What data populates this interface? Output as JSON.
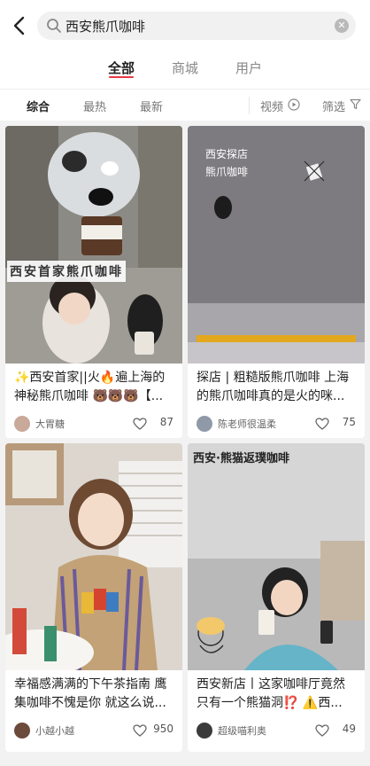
{
  "search": {
    "query": "西安熊爪咖啡"
  },
  "tabs": [
    {
      "label": "全部",
      "active": true
    },
    {
      "label": "商城",
      "active": false
    },
    {
      "label": "用户",
      "active": false
    }
  ],
  "filters": {
    "items": [
      "综合",
      "最热",
      "最新"
    ],
    "video": "视频",
    "screen": "筛选"
  },
  "colors": {
    "accent": "#e63946",
    "like_icon": "#666666"
  },
  "cards": [
    {
      "title": "✨西安首家||火🔥遍上海的神秘熊爪咖啡 🐻🐻🐻【...",
      "author": "大胃糖",
      "likes": "87",
      "overlay": "西安首家熊爪咖啡"
    },
    {
      "title": "探店 | 粗糙版熊爪咖啡 上海的熊爪咖啡真的是火的咪...",
      "author": "陈老师很温柔",
      "likes": "75",
      "overlay": "西安探店\n熊爪咖啡"
    },
    {
      "title": "幸福感满满的下午茶指南 鹰集咖啡不愧是你 就这么说...",
      "author": "小越小越",
      "likes": "950",
      "overlay": ""
    },
    {
      "title": "西安新店丨这家咖啡厅竟然只有一个熊猫洞⁉️ ⚠️西...",
      "author": "超级喵利奥",
      "likes": "49",
      "overlay": "西安·熊猫返璞咖啡"
    }
  ]
}
